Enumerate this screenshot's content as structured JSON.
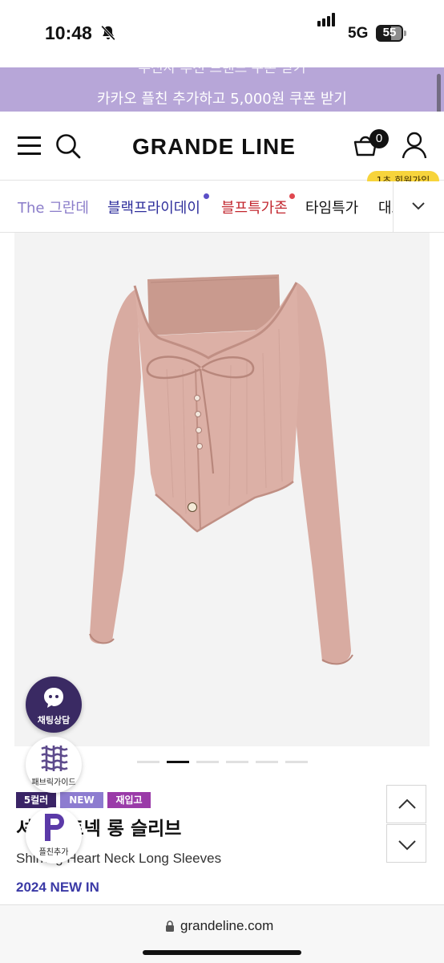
{
  "status_bar": {
    "time": "10:48",
    "network": "5G",
    "battery_level": "55"
  },
  "promo_banner": {
    "previous_text": "무신사 추천 브랜드 쿠폰 받기",
    "text": "카카오 플친 추가하고 5,000원 쿠폰 받기",
    "color": "#b7a6d8"
  },
  "header": {
    "logo": "GRANDE LINE",
    "cart_count": "0",
    "signup_badge": "1초 회원가입"
  },
  "category_nav": {
    "items": [
      {
        "label": "The 그란데",
        "color": "#8a7cc9"
      },
      {
        "label": "블랙프라이데이",
        "color": "#2f2f9c",
        "dot": "#5b4fc7"
      },
      {
        "label": "블프특가존",
        "color": "#c2262e",
        "dot": "#e0474f"
      },
      {
        "label": "타임특가",
        "color": "#111111"
      },
      {
        "label": "대표",
        "color": "#111111"
      }
    ]
  },
  "floating": {
    "chat_label": "채팅상담",
    "fabric_label": "패브릭가이드",
    "plus_label": "플친추가"
  },
  "product": {
    "badges": [
      {
        "label": "5컬러",
        "color": "#3a2466"
      },
      {
        "label": "NEW",
        "color": "#8d7cd0"
      },
      {
        "label": "재입고",
        "color": "#9a3aa8"
      }
    ],
    "title": "셔링하트넥 롱 슬리브",
    "subtitle": "Shirring Heart Neck Long Sleeves",
    "season": "2024 NEW IN",
    "carousel_count": 6,
    "carousel_active": 1
  },
  "address_bar": {
    "url": "grandeline.com"
  }
}
